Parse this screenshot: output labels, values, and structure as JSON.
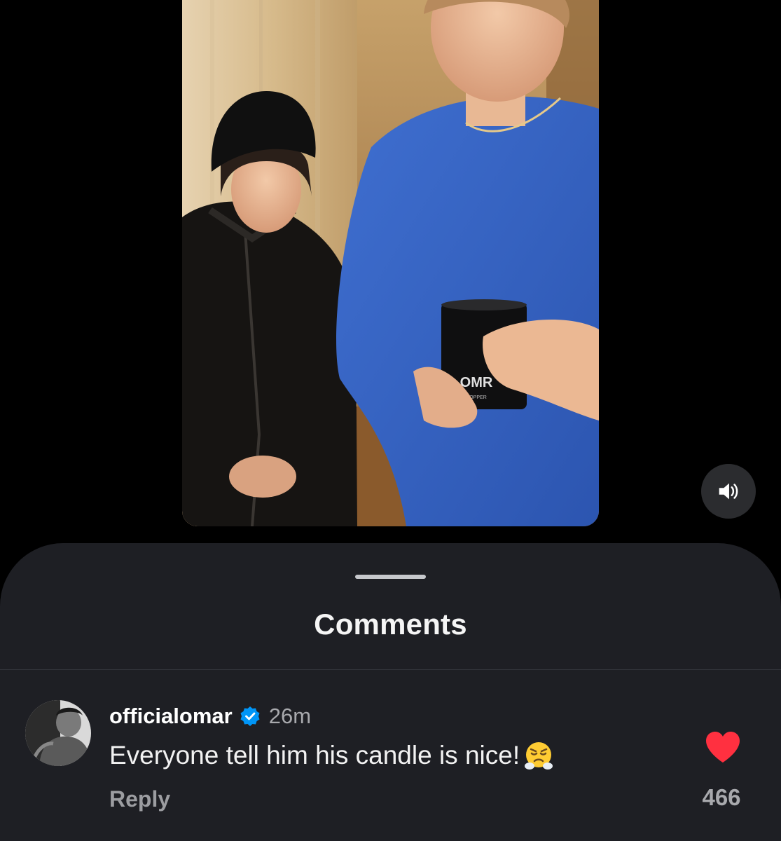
{
  "sheet": {
    "title": "Comments"
  },
  "comment": {
    "username": "officialomar",
    "timestamp": "26m",
    "text": "Everyone tell him his candle is nice!",
    "emoji_icon": "face-with-steam-from-nose-icon",
    "reply_label": "Reply",
    "like_count": "466",
    "liked": true
  },
  "video": {
    "product_label": "OMR",
    "product_sublabel": "COPPER"
  },
  "colors": {
    "background": "#000000",
    "sheet": "#1e1f24",
    "heart": "#ff3040",
    "verified": "#0095f6",
    "secondary_text": "#a8a9ad"
  }
}
